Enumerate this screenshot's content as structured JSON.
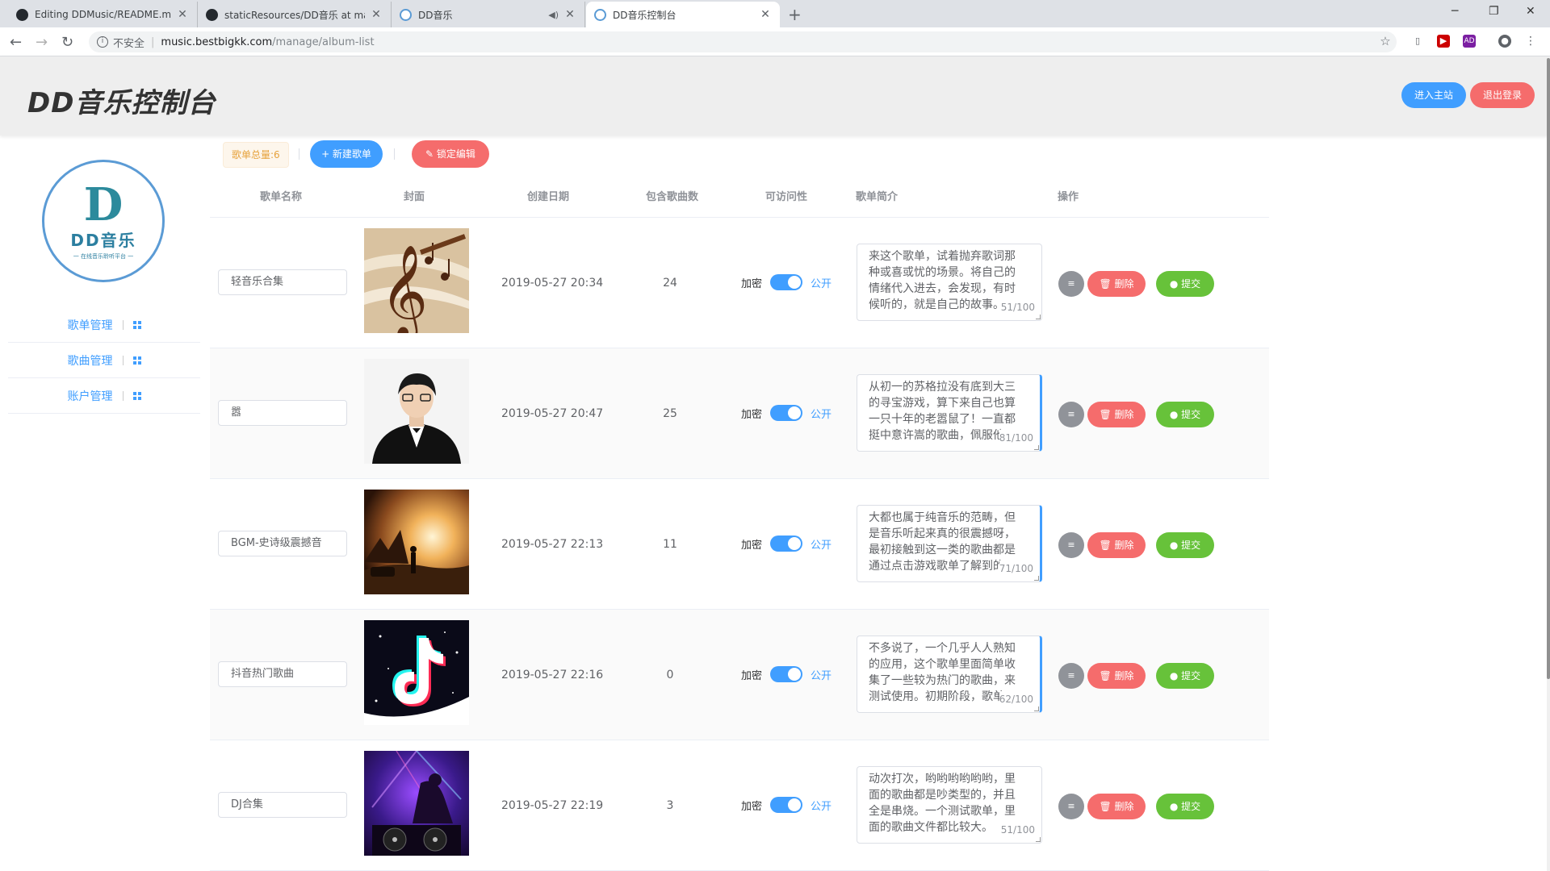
{
  "browser": {
    "tabs": [
      {
        "title": "Editing DDMusic/README.md at",
        "icon": "github-icon"
      },
      {
        "title": "staticResources/DD音乐 at maste",
        "icon": "github-icon"
      },
      {
        "title": "DD音乐",
        "icon": "dd-music-icon"
      },
      {
        "title": "DD音乐控制台",
        "icon": "dd-music-icon"
      }
    ],
    "security_label": "不安全",
    "url_host": "music.bestbigkk.com",
    "url_path": "/manage/album-list"
  },
  "header": {
    "title": "DD音乐控制台",
    "home_button": "进入主站",
    "logout_button": "退出登录"
  },
  "sidebar": {
    "logo": {
      "mark": "D",
      "name": "DD音乐",
      "slogan": "一 在线音乐聆听平台 一"
    },
    "items": [
      {
        "label": "歌单管理"
      },
      {
        "label": "歌曲管理"
      },
      {
        "label": "账户管理"
      }
    ]
  },
  "actions": {
    "count_label": "歌单总量:6",
    "new_button": "+ 新建歌单",
    "lock_button": "锁定编辑"
  },
  "table": {
    "columns": [
      "歌单名称",
      "封面",
      "创建日期",
      "包含歌曲数",
      "可访问性",
      "歌单简介",
      "操作"
    ],
    "switch_off_label": "加密",
    "switch_on_label": "公开",
    "delete_label": "删除",
    "submit_label": "提交",
    "rows": [
      {
        "name": "轻音乐合集",
        "date": "2019-05-27 20:34",
        "count": "24",
        "desc": "来这个歌单，试着抛弃歌词那种或喜或忧的场景。将自己的情绪代入进去，会发现，有时候听的，就是自己的故事。",
        "limit": "51/100",
        "cover": "music-notes-cover",
        "public": true
      },
      {
        "name": "嚣",
        "date": "2019-05-27 20:47",
        "count": "25",
        "desc": "从初一的苏格拉没有底到大三的寻宝游戏，算下来自己也算一只十年的老嚣鼠了！一直都挺中意许嵩的歌曲，佩服他",
        "limit": "81/100",
        "cover": "singer-portrait-cover",
        "public": true
      },
      {
        "name": "BGM-史诗级震撼音",
        "date": "2019-05-27 22:13",
        "count": "11",
        "desc": "大都也属于纯音乐的范畴，但是音乐听起来真的很震撼呀，最初接触到这一类的歌曲都是通过点击游戏歌单了解到的",
        "limit": "71/100",
        "cover": "sunset-cover",
        "public": true
      },
      {
        "name": "抖音热门歌曲",
        "date": "2019-05-27 22:16",
        "count": "0",
        "desc": "不多说了，一个几乎人人熟知的应用，这个歌单里面简单收集了一些较为热门的歌曲，来测试使用。初期阶段，歌单",
        "limit": "62/100",
        "cover": "tiktok-cover",
        "public": true
      },
      {
        "name": "DJ合集",
        "date": "2019-05-27 22:19",
        "count": "3",
        "desc": "动次打次，哟哟哟哟哟哟，里面的歌曲都是吵类型的，并且全是串烧。一个测试歌单，里面的歌曲文件都比较大。",
        "limit": "51/100",
        "cover": "dj-club-cover",
        "public": true
      }
    ]
  },
  "colors": {
    "primary": "#409eff",
    "danger": "#f56c6c",
    "success": "#67c23a",
    "info": "#909399",
    "warning": "#e6a23c"
  }
}
